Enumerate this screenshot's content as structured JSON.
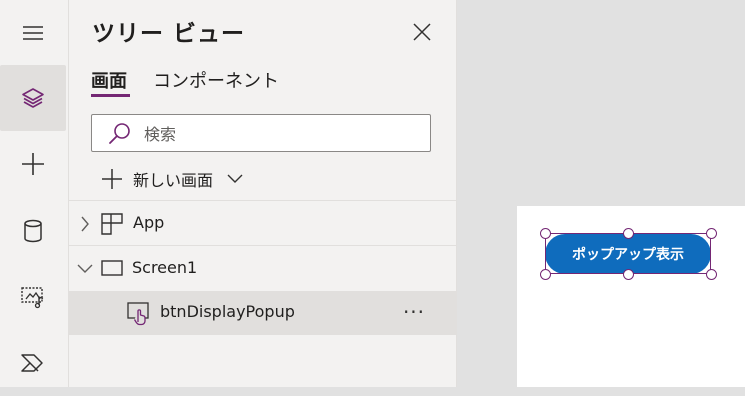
{
  "rail": {
    "items": [
      {
        "icon": "hamburger-menu-icon"
      },
      {
        "icon": "layers-icon",
        "active": true
      },
      {
        "icon": "plus-icon"
      },
      {
        "icon": "database-icon"
      },
      {
        "icon": "media-icon"
      },
      {
        "icon": "power-automate-icon"
      }
    ]
  },
  "tree_panel": {
    "title": "ツリー ビュー",
    "tabs": [
      {
        "label": "画面",
        "selected": true
      },
      {
        "label": "コンポーネント",
        "selected": false
      }
    ],
    "search": {
      "placeholder": "検索",
      "value": ""
    },
    "new_screen_label": "新しい画面",
    "nodes": [
      {
        "label": "App",
        "icon": "app-icon",
        "expander": "chevron-right"
      },
      {
        "label": "Screen1",
        "icon": "screen-icon",
        "expander": "chevron-down"
      },
      {
        "label": "btnDisplayPopup",
        "icon": "button-control-icon",
        "selected": true,
        "more": "···"
      }
    ]
  },
  "canvas": {
    "button_label": "ポップアップ表示"
  },
  "colors": {
    "accent": "#742774",
    "button": "#0f6cbd",
    "panel_bg": "#f3f2f1",
    "workspace_bg": "#e1e1e1"
  }
}
